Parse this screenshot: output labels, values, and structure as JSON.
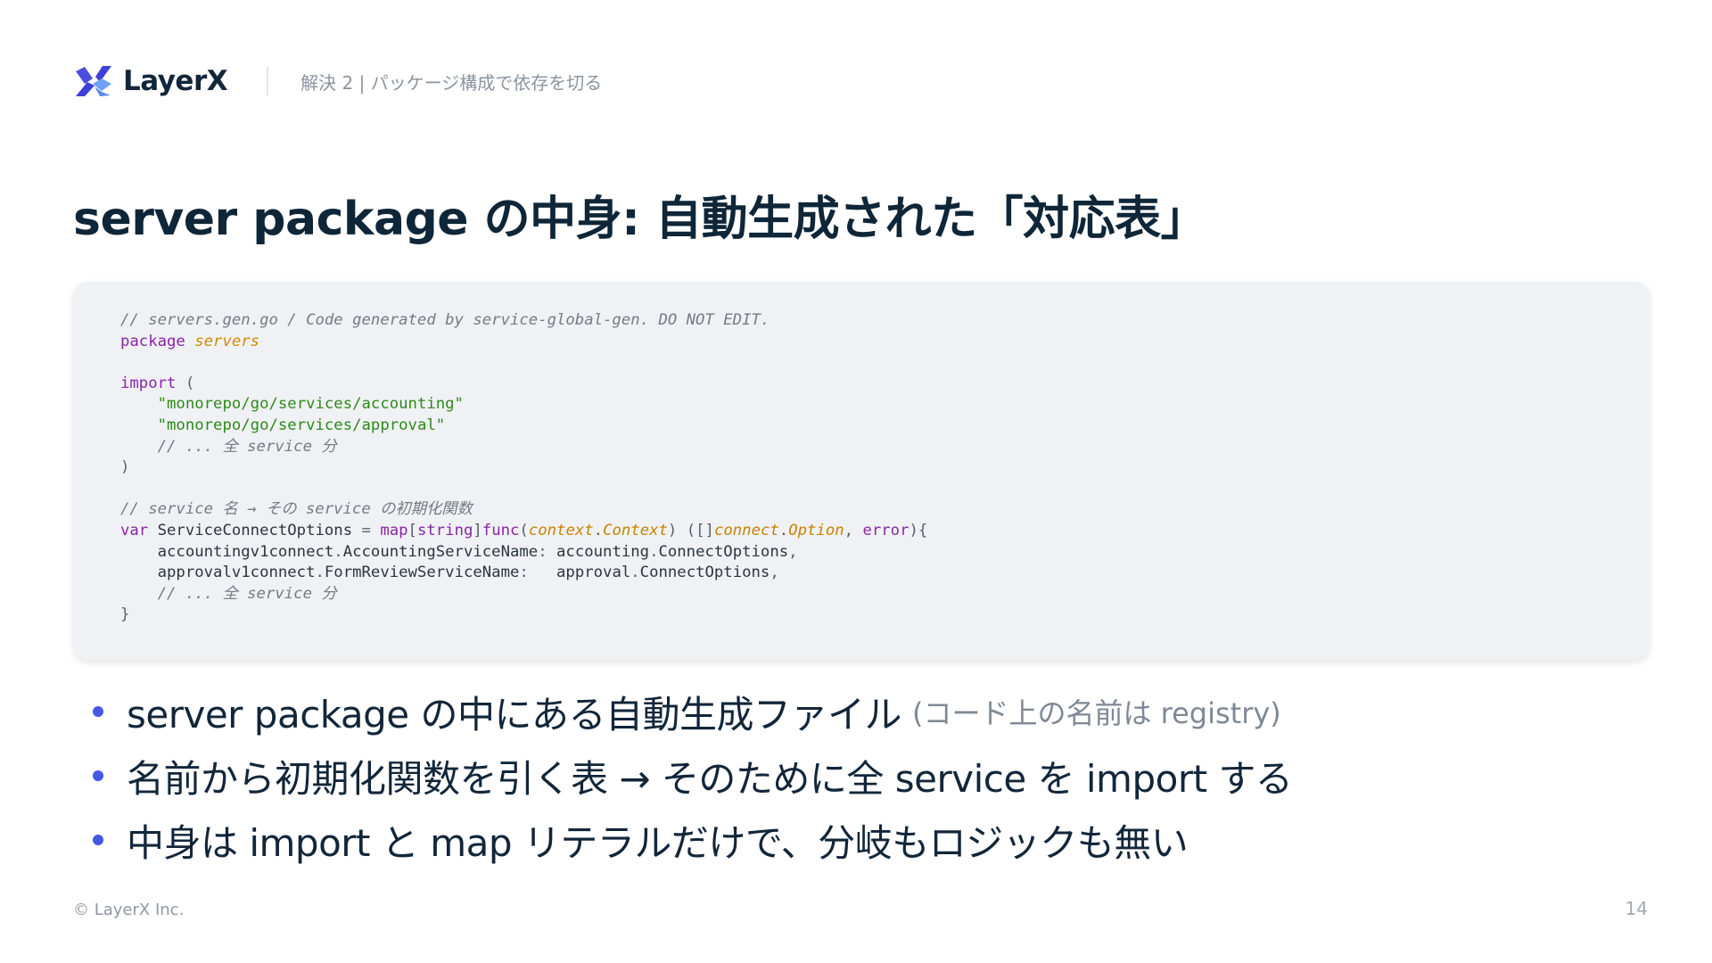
{
  "header": {
    "logo_text": "LayerX",
    "section": "解決 2 | パッケージ構成で依存を切る"
  },
  "title": "server package の中身: 自動生成された「対応表」",
  "code": {
    "lines": [
      [
        {
          "t": "// servers.gen.go / Code generated by service-global-gen. DO NOT EDIT.",
          "k": "comment"
        }
      ],
      [
        {
          "t": "package",
          "k": "keyword"
        },
        {
          "t": " ",
          "k": "plain"
        },
        {
          "t": "servers",
          "k": "pkgname"
        }
      ],
      [],
      [
        {
          "t": "import",
          "k": "keyword"
        },
        {
          "t": " (",
          "k": "punct"
        }
      ],
      [
        {
          "t": "    ",
          "k": "plain"
        },
        {
          "t": "\"monorepo/go/services/accounting\"",
          "k": "string"
        }
      ],
      [
        {
          "t": "    ",
          "k": "plain"
        },
        {
          "t": "\"monorepo/go/services/approval\"",
          "k": "string"
        }
      ],
      [
        {
          "t": "    ",
          "k": "plain"
        },
        {
          "t": "// ... 全 service 分",
          "k": "comment"
        }
      ],
      [
        {
          "t": ")",
          "k": "punct"
        }
      ],
      [],
      [
        {
          "t": "// service 名 → その service の初期化関数",
          "k": "comment"
        }
      ],
      [
        {
          "t": "var",
          "k": "keyword"
        },
        {
          "t": " ServiceConnectOptions ",
          "k": "plain"
        },
        {
          "t": "=",
          "k": "punct"
        },
        {
          "t": " ",
          "k": "plain"
        },
        {
          "t": "map",
          "k": "keyword"
        },
        {
          "t": "[",
          "k": "punct"
        },
        {
          "t": "string",
          "k": "keyword"
        },
        {
          "t": "]",
          "k": "punct"
        },
        {
          "t": "func",
          "k": "keyword"
        },
        {
          "t": "(",
          "k": "punct"
        },
        {
          "t": "context",
          "k": "type"
        },
        {
          "t": ".",
          "k": "punct"
        },
        {
          "t": "Context",
          "k": "type"
        },
        {
          "t": ") ([]",
          "k": "punct"
        },
        {
          "t": "connect",
          "k": "type"
        },
        {
          "t": ".",
          "k": "punct"
        },
        {
          "t": "Option",
          "k": "type"
        },
        {
          "t": ", ",
          "k": "punct"
        },
        {
          "t": "error",
          "k": "keyword"
        },
        {
          "t": "){",
          "k": "punct"
        }
      ],
      [
        {
          "t": "    accountingv1connect",
          "k": "plain"
        },
        {
          "t": ".",
          "k": "punct"
        },
        {
          "t": "AccountingServiceName",
          "k": "plain"
        },
        {
          "t": ": ",
          "k": "punct"
        },
        {
          "t": "accounting",
          "k": "plain"
        },
        {
          "t": ".",
          "k": "punct"
        },
        {
          "t": "ConnectOptions",
          "k": "plain"
        },
        {
          "t": ",",
          "k": "punct"
        }
      ],
      [
        {
          "t": "    approvalv1connect",
          "k": "plain"
        },
        {
          "t": ".",
          "k": "punct"
        },
        {
          "t": "FormReviewServiceName",
          "k": "plain"
        },
        {
          "t": ":   ",
          "k": "punct"
        },
        {
          "t": "approval",
          "k": "plain"
        },
        {
          "t": ".",
          "k": "punct"
        },
        {
          "t": "ConnectOptions",
          "k": "plain"
        },
        {
          "t": ",",
          "k": "punct"
        }
      ],
      [
        {
          "t": "    ",
          "k": "plain"
        },
        {
          "t": "// ... 全 service 分",
          "k": "comment"
        }
      ],
      [
        {
          "t": "}",
          "k": "punct"
        }
      ]
    ]
  },
  "bullets": [
    {
      "text": "server package の中にある自動生成ファイル",
      "note": "(コード上の名前は registry)"
    },
    {
      "text": "名前から初期化関数を引く表 → そのために全 service を import する",
      "note": ""
    },
    {
      "text": "中身は import と map リテラルだけで、分岐もロジックも無い",
      "note": ""
    }
  ],
  "footer": {
    "copyright": "© LayerX Inc.",
    "page_number": "14"
  },
  "colors": {
    "logo_dark": "#3d3fd6",
    "logo_light": "#5a8cf0",
    "bullet": "#4656e5",
    "title": "#0e2638",
    "code_bg": "#f0f1f4"
  },
  "icons": {
    "logo": "layerx-logo-icon"
  }
}
